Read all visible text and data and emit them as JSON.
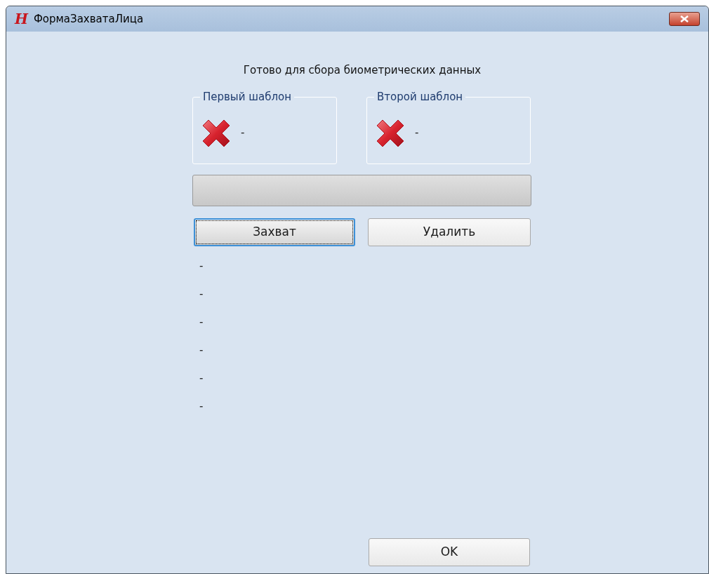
{
  "window": {
    "title": "ФормаЗахватаЛица",
    "logo": "H"
  },
  "status_text": "Готово для сбора биометрических данных",
  "templates": [
    {
      "label": "Первый шаблон",
      "kind": "fail",
      "value": "-"
    },
    {
      "label": "Второй шаблон",
      "kind": "fail",
      "value": "-"
    }
  ],
  "progress": {
    "level": 0
  },
  "buttons": [
    {
      "label": "Захват",
      "focused": true
    },
    {
      "label": "Удалить",
      "focused": false
    }
  ],
  "log_lines": [
    "-",
    "-",
    "-",
    "-",
    "-",
    "-"
  ],
  "ok_button": {
    "label": "OK",
    "focused": false
  }
}
